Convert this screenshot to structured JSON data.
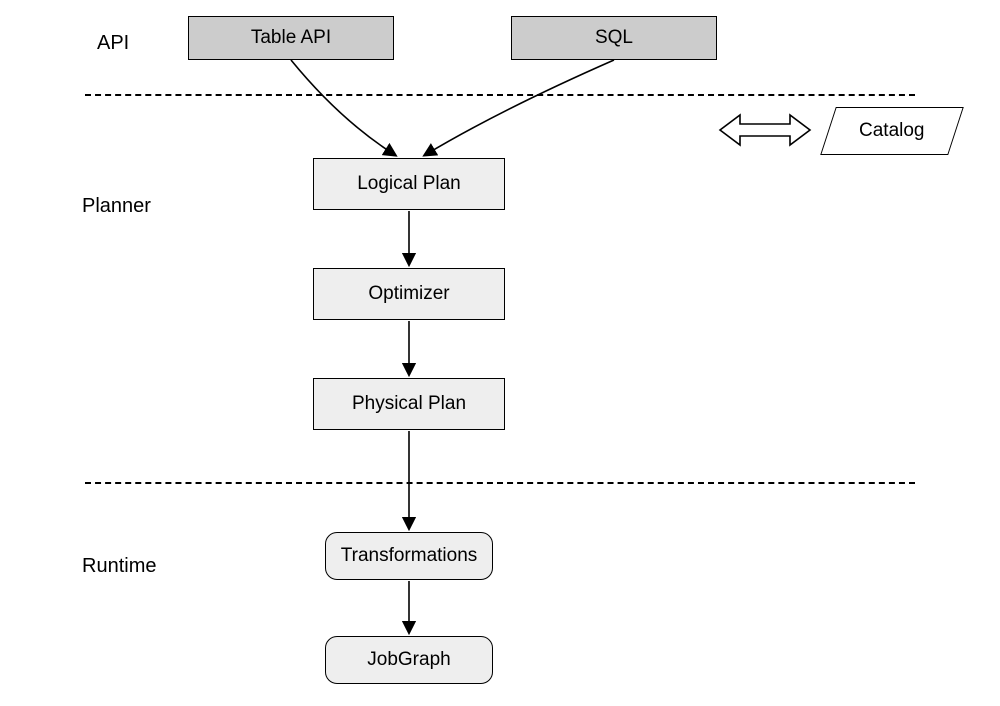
{
  "labels": {
    "api": "API",
    "planner": "Planner",
    "runtime": "Runtime"
  },
  "nodes": {
    "table_api": "Table API",
    "sql": "SQL",
    "logical_plan": "Logical Plan",
    "optimizer": "Optimizer",
    "physical_plan": "Physical Plan",
    "transformations": "Transformations",
    "jobgraph": "JobGraph",
    "catalog": "Catalog"
  },
  "flow": {
    "sections": [
      "API",
      "Planner",
      "Runtime"
    ],
    "api_inputs": [
      "Table API",
      "SQL"
    ],
    "planner_steps": [
      "Logical Plan",
      "Optimizer",
      "Physical Plan"
    ],
    "runtime_steps": [
      "Transformations",
      "JobGraph"
    ],
    "catalog_connects_to": "Planner (bidirectional)"
  }
}
